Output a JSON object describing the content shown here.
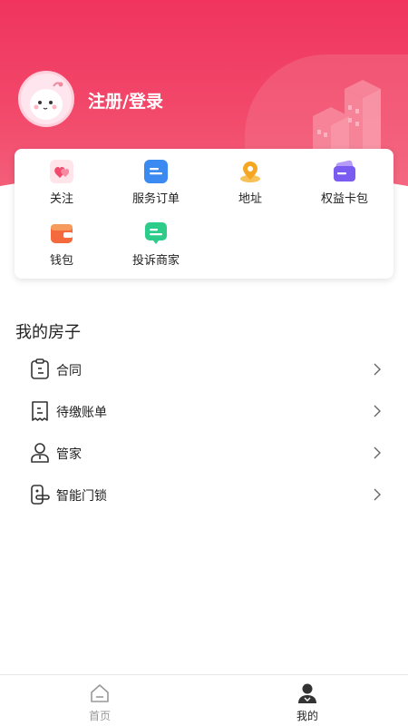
{
  "user": {
    "login_label": "注册/登录"
  },
  "quick_menu": [
    {
      "label": "关注",
      "icon": "heart-icon"
    },
    {
      "label": "服务订单",
      "icon": "order-icon"
    },
    {
      "label": "地址",
      "icon": "location-pin-icon"
    },
    {
      "label": "权益卡包",
      "icon": "card-wallet-icon"
    },
    {
      "label": "钱包",
      "icon": "wallet-icon"
    },
    {
      "label": "投诉商家",
      "icon": "complaint-icon"
    }
  ],
  "my_house": {
    "title": "我的房子",
    "items": [
      {
        "label": "合同",
        "icon": "contract-icon"
      },
      {
        "label": "待缴账单",
        "icon": "bill-icon"
      },
      {
        "label": "管家",
        "icon": "housekeeper-icon"
      },
      {
        "label": "智能门锁",
        "icon": "smart-lock-icon"
      }
    ]
  },
  "tabbar": {
    "home_label": "首页",
    "mine_label": "我的",
    "active": "mine"
  },
  "colors": {
    "brand": "#f0345e",
    "accent_blue": "#3b8af2",
    "accent_orange": "#f5a623",
    "accent_purple": "#7b5cf0",
    "accent_green": "#2ecc8a"
  }
}
